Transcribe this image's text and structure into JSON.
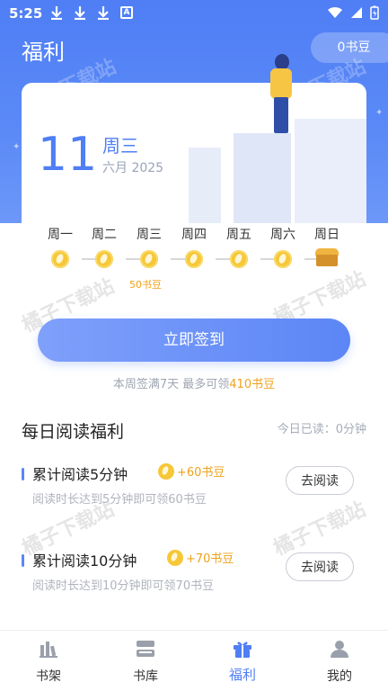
{
  "status_bar": {
    "time": "5:25",
    "download_icons": [
      "download-icon",
      "download-icon",
      "download-icon"
    ],
    "app_icon": "A",
    "right_icons": [
      "wifi-icon",
      "signal-icon",
      "battery-icon"
    ]
  },
  "header": {
    "title": "福利",
    "coins": "0书豆"
  },
  "date_card": {
    "day": "11",
    "weekday": "周三",
    "month_year": "六月 2025"
  },
  "week": {
    "days": [
      "周一",
      "周二",
      "周三",
      "周四",
      "周五",
      "周六",
      "周日"
    ],
    "bonus_label": "50书豆",
    "icons": [
      "coin-icon",
      "coin-icon",
      "coin-icon",
      "coin-icon",
      "coin-icon",
      "coin-icon",
      "treasure-chest-icon"
    ]
  },
  "checkin": {
    "button_label": "立即签到",
    "hint_prefix": "本周签满7天 最多可领",
    "hint_amount": "410书豆"
  },
  "daily_reading": {
    "title": "每日阅读福利",
    "today_read": "今日已读：0分钟",
    "tasks": [
      {
        "name": "累计阅读5分钟",
        "reward": "+60书豆",
        "desc": "阅读时长达到5分钟即可领60书豆",
        "button": "去阅读"
      },
      {
        "name": "累计阅读10分钟",
        "reward": "+70书豆",
        "desc": "阅读时长达到10分钟即可领70书豆",
        "button": "去阅读"
      }
    ]
  },
  "watermark": "橘子下载站",
  "tabbar": {
    "items": [
      {
        "label": "书架",
        "icon": "bookshelf-icon"
      },
      {
        "label": "书库",
        "icon": "library-icon"
      },
      {
        "label": "福利",
        "icon": "gift-icon",
        "active": true
      },
      {
        "label": "我的",
        "icon": "user-icon"
      }
    ]
  },
  "colors": {
    "accent": "#4f7ef5",
    "coin": "#f6c737",
    "reward_text": "#f0a21a"
  }
}
